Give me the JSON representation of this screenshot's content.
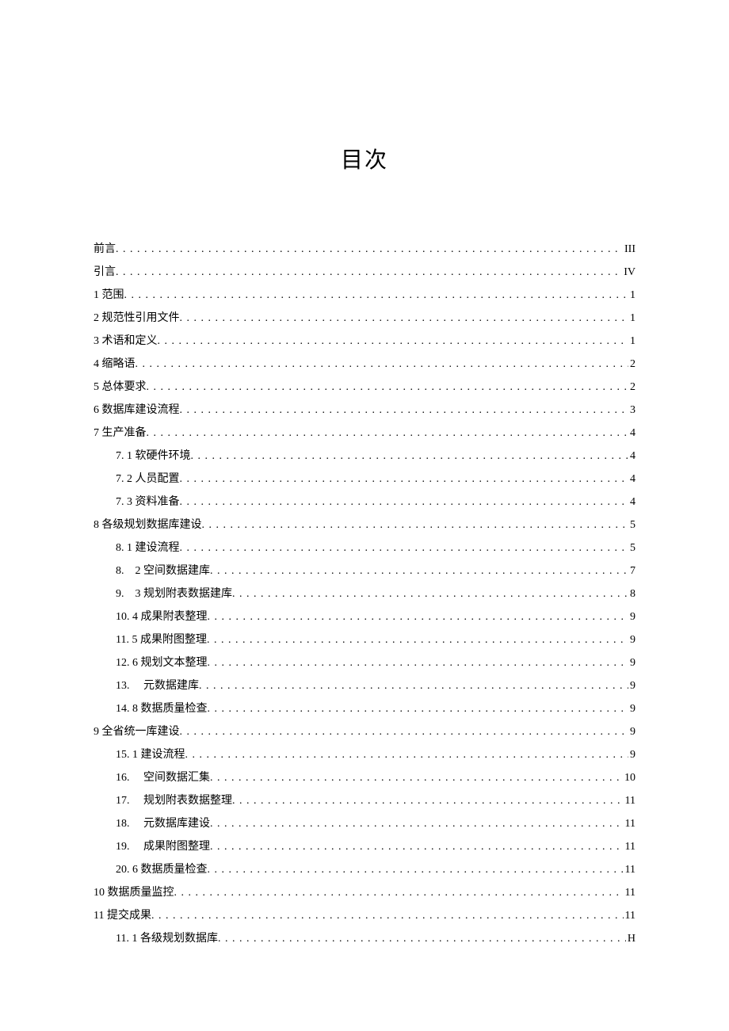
{
  "title": "目次",
  "entries": [
    {
      "label": "前言",
      "page": "III",
      "indent": false
    },
    {
      "label": "引言",
      "page": "IV",
      "indent": false
    },
    {
      "label": "1 范围",
      "page": "1",
      "indent": false
    },
    {
      "label": "2 规范性引用文件",
      "page": "1",
      "indent": false
    },
    {
      "label": "3 术语和定义",
      "page": "1",
      "indent": false
    },
    {
      "label": "4 缩略语",
      "page": "2",
      "indent": false
    },
    {
      "label": "5 总体要求",
      "page": "2",
      "indent": false
    },
    {
      "label": "6 数据库建设流程",
      "page": "3",
      "indent": false
    },
    {
      "label": "7 生产准备",
      "page": "4",
      "indent": false
    },
    {
      "label": "7. 1 软硬件环境",
      "page": "4",
      "indent": true
    },
    {
      "label": "7. 2 人员配置",
      "page": "4",
      "indent": true
    },
    {
      "label": "7. 3 资料准备",
      "page": "4",
      "indent": true
    },
    {
      "label": "8 各级规划数据库建设",
      "page": "5",
      "indent": false
    },
    {
      "label": "8. 1 建设流程",
      "page": "5",
      "indent": true
    },
    {
      "label": "8.　2 空间数据建库",
      "page": "7",
      "indent": true
    },
    {
      "label": "9.　3 规划附表数据建库",
      "page": "8",
      "indent": true
    },
    {
      "label": "10. 4 成果附表整理",
      "page": "9",
      "indent": true
    },
    {
      "label": "11. 5 成果附图整理",
      "page": "9",
      "indent": true
    },
    {
      "label": "12. 6 规划文本整理",
      "page": "9",
      "indent": true
    },
    {
      "label": "13.　 元数据建库",
      "page": "9",
      "indent": true
    },
    {
      "label": "14. 8 数据质量检查",
      "page": "9",
      "indent": true
    },
    {
      "label": "9 全省统一库建设",
      "page": "9",
      "indent": false
    },
    {
      "label": "15. 1 建设流程",
      "page": "9",
      "indent": true
    },
    {
      "label": "16.　 空间数据汇集",
      "page": "10",
      "indent": true
    },
    {
      "label": "17.　 规划附表数据整理",
      "page": "11",
      "indent": true
    },
    {
      "label": "18.　 元数据库建设",
      "page": "11",
      "indent": true
    },
    {
      "label": "19.　 成果附图整理",
      "page": "11",
      "indent": true
    },
    {
      "label": "20. 6 数据质量检查",
      "page": "11",
      "indent": true
    },
    {
      "label": "10 数据质量监控",
      "page": "11",
      "indent": false
    },
    {
      "label": "11 提交成果",
      "page": "11",
      "indent": false
    },
    {
      "label": "11. 1 各级规划数据库",
      "page": "H",
      "indent": true
    }
  ]
}
